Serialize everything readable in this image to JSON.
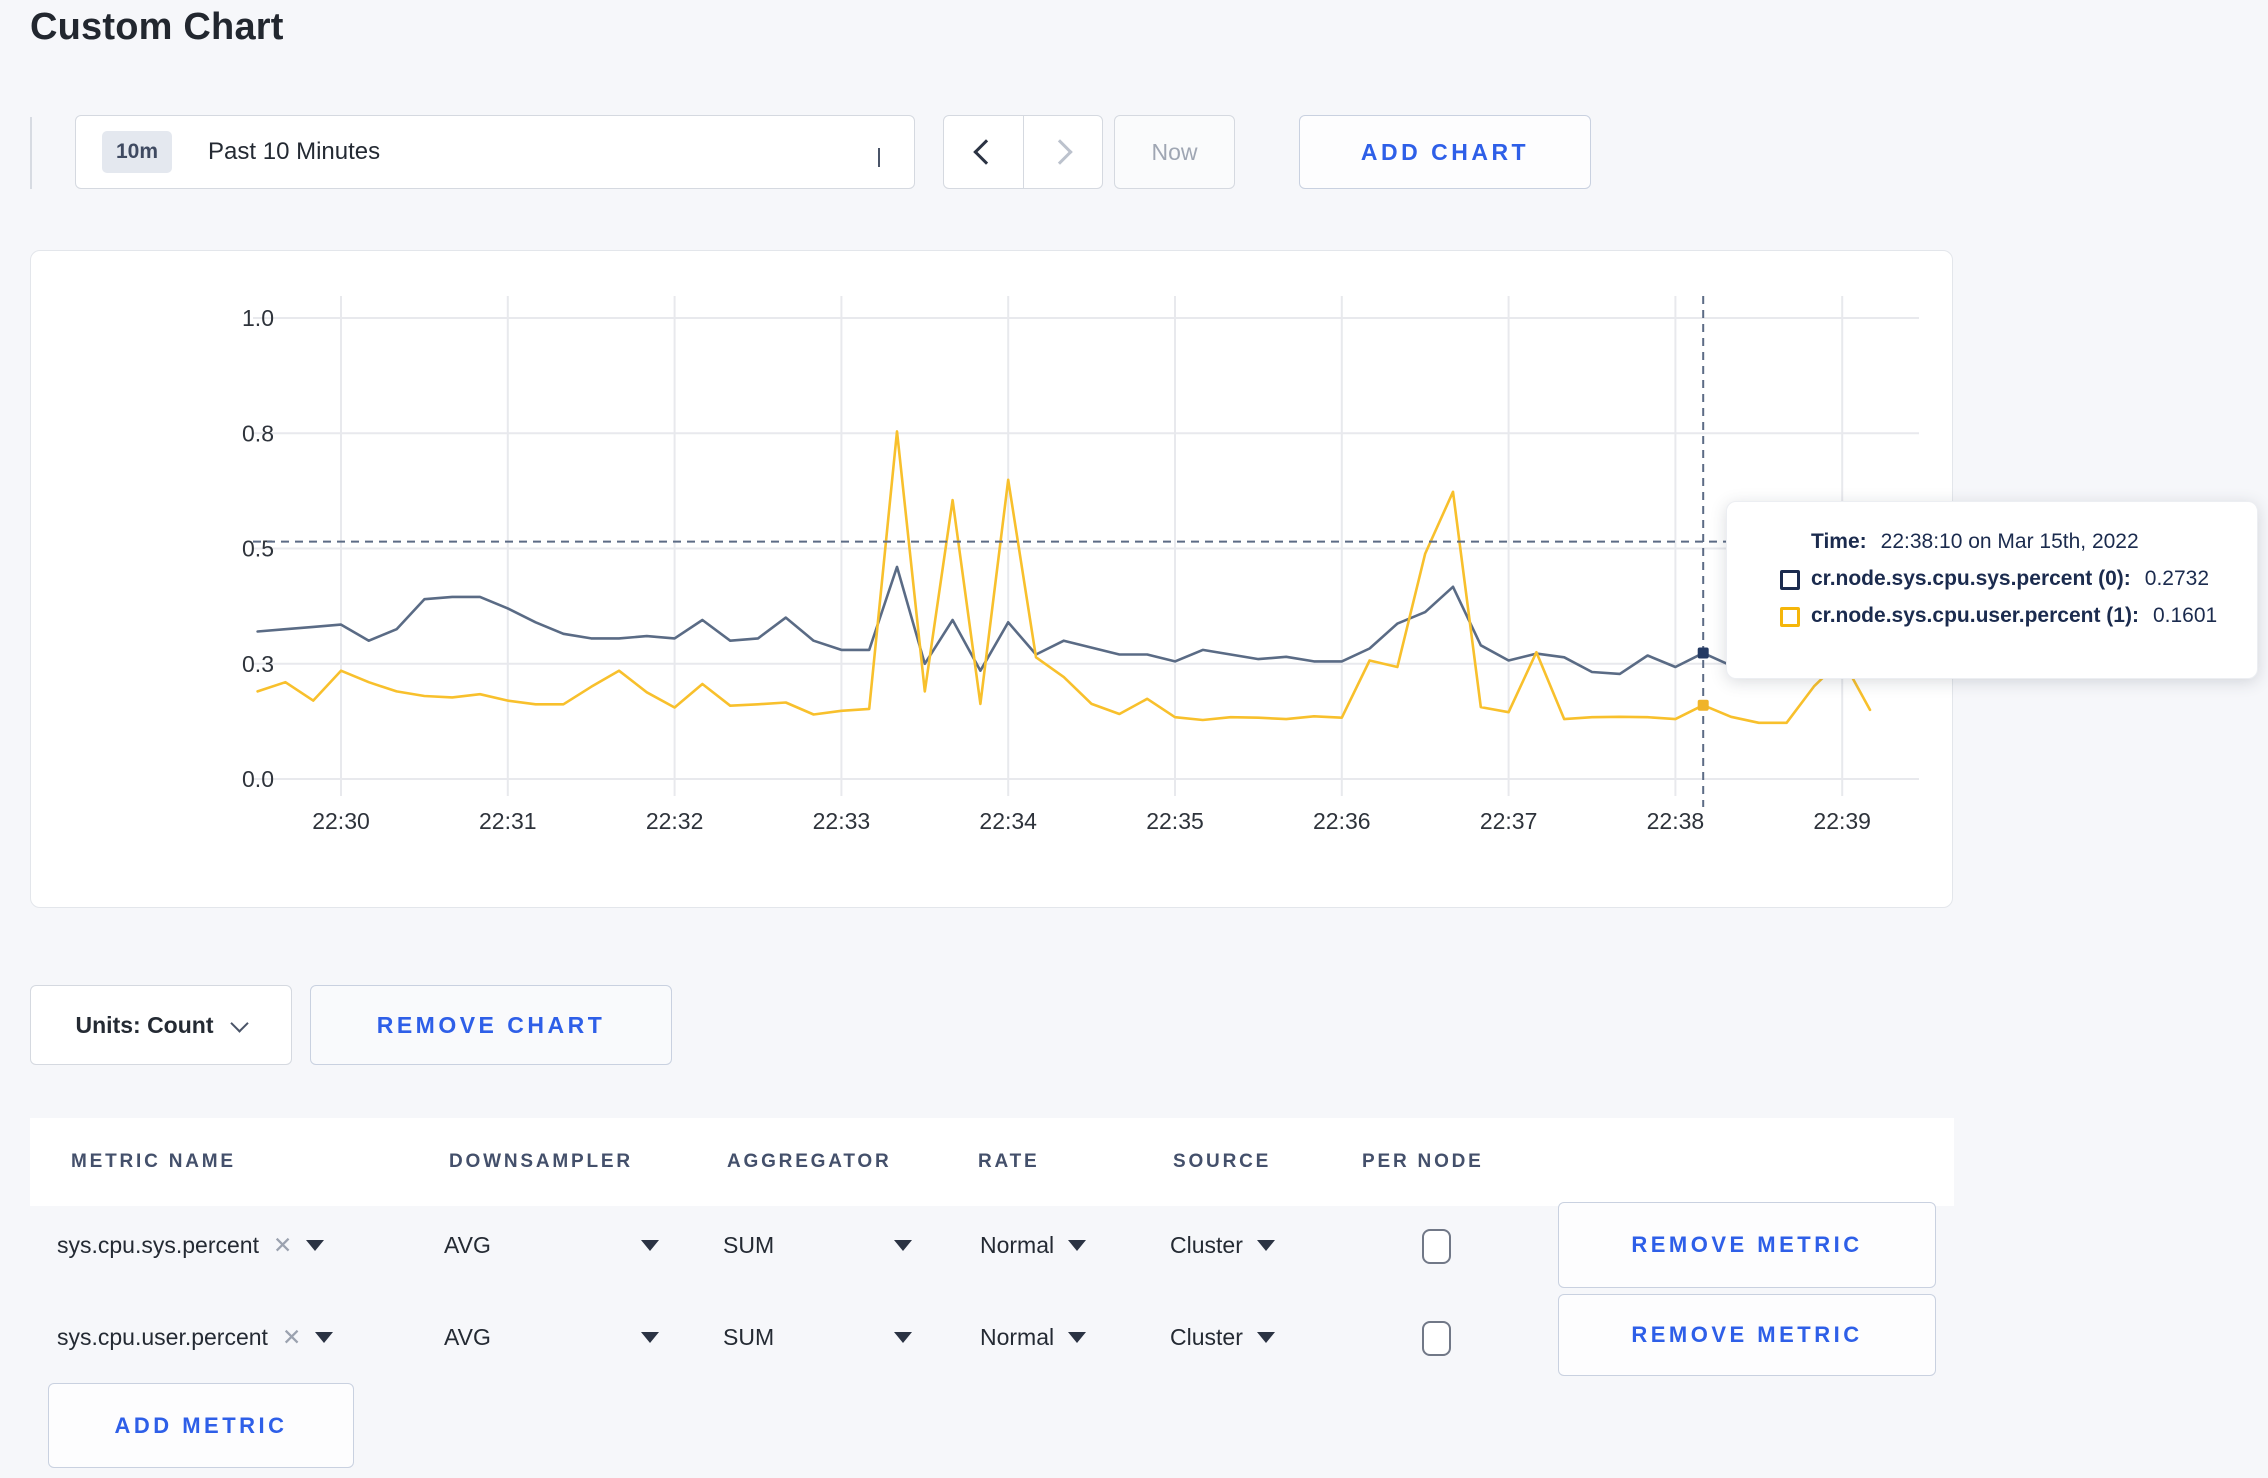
{
  "page": {
    "title": "Custom Chart"
  },
  "toolbar": {
    "time_range_badge": "10m",
    "time_range_label": "Past 10 Minutes",
    "now_label": "Now",
    "add_chart_label": "ADD CHART"
  },
  "tooltip": {
    "time_label": "Time:",
    "time_value": "22:38:10 on Mar 15th, 2022",
    "rows": [
      {
        "name": "cr.node.sys.cpu.sys.percent (0):",
        "value": "0.2732",
        "color": "#1b2b4e"
      },
      {
        "name": "cr.node.sys.cpu.user.percent (1):",
        "value": "0.1601",
        "color": "#f5b60a"
      }
    ]
  },
  "units_bar": {
    "units_label": "Units: Count",
    "remove_chart_label": "REMOVE CHART"
  },
  "metrics_table": {
    "headers": [
      "METRIC NAME",
      "DOWNSAMPLER",
      "AGGREGATOR",
      "RATE",
      "SOURCE",
      "PER NODE"
    ],
    "clear_glyph": "✕",
    "rows": [
      {
        "name": "sys.cpu.sys.percent",
        "downsampler": "AVG",
        "aggregator": "SUM",
        "rate": "Normal",
        "source": "Cluster",
        "per_node_checked": false,
        "remove_label": "REMOVE METRIC"
      },
      {
        "name": "sys.cpu.user.percent",
        "downsampler": "AVG",
        "aggregator": "SUM",
        "rate": "Normal",
        "source": "Cluster",
        "per_node_checked": false,
        "remove_label": "REMOVE METRIC"
      }
    ],
    "add_metric_label": "ADD METRIC"
  },
  "chart_data": {
    "type": "line",
    "title": "",
    "x_start": "22:29:30",
    "x_interval_seconds": 10,
    "x_tick_labels": [
      "22:30",
      "22:31",
      "22:32",
      "22:33",
      "22:34",
      "22:35",
      "22:36",
      "22:37",
      "22:38",
      "22:39"
    ],
    "y_tick_labels": [
      "0.0",
      "0.3",
      "0.5",
      "0.8",
      "1.0"
    ],
    "y_tick_values": [
      0,
      0.25,
      0.5,
      0.75,
      1.0
    ],
    "ylim": [
      0,
      1.0
    ],
    "grid": true,
    "legend_position": "tooltip-only",
    "series": [
      {
        "name": "cr.node.sys.cpu.sys.percent (0)",
        "color": "#5a6b85",
        "dot_color": "#243a63",
        "values": [
          0.32,
          0.325,
          0.33,
          0.335,
          0.3,
          0.325,
          0.39,
          0.395,
          0.395,
          0.37,
          0.34,
          0.315,
          0.305,
          0.305,
          0.31,
          0.305,
          0.345,
          0.3,
          0.305,
          0.35,
          0.3,
          0.28,
          0.28,
          0.46,
          0.25,
          0.345,
          0.235,
          0.34,
          0.27,
          0.3,
          0.285,
          0.27,
          0.27,
          0.255,
          0.28,
          0.27,
          0.26,
          0.265,
          0.255,
          0.255,
          0.283,
          0.337,
          0.362,
          0.417,
          0.29,
          0.257,
          0.272,
          0.264,
          0.232,
          0.228,
          0.268,
          0.243,
          0.2732,
          0.246,
          0.3,
          0.31,
          0.3,
          0.295,
          0.25
        ]
      },
      {
        "name": "cr.node.sys.cpu.user.percent (1)",
        "color": "#f8c02c",
        "dot_color": "#f0b429",
        "values": [
          0.19,
          0.21,
          0.17,
          0.235,
          0.21,
          0.19,
          0.18,
          0.177,
          0.184,
          0.17,
          0.162,
          0.162,
          0.2,
          0.235,
          0.188,
          0.155,
          0.206,
          0.159,
          0.162,
          0.166,
          0.14,
          0.148,
          0.152,
          0.754,
          0.19,
          0.605,
          0.163,
          0.649,
          0.264,
          0.221,
          0.163,
          0.141,
          0.174,
          0.134,
          0.128,
          0.134,
          0.133,
          0.13,
          0.136,
          0.133,
          0.257,
          0.243,
          0.489,
          0.623,
          0.156,
          0.145,
          0.275,
          0.13,
          0.134,
          0.135,
          0.134,
          0.13,
          0.1601,
          0.135,
          0.122,
          0.122,
          0.202,
          0.26,
          0.15
        ]
      }
    ],
    "crosshair": {
      "index": 52,
      "time": "22:38:10",
      "y_value": 0.515,
      "sys_value": 0.2732,
      "user_value": 0.1601
    }
  }
}
